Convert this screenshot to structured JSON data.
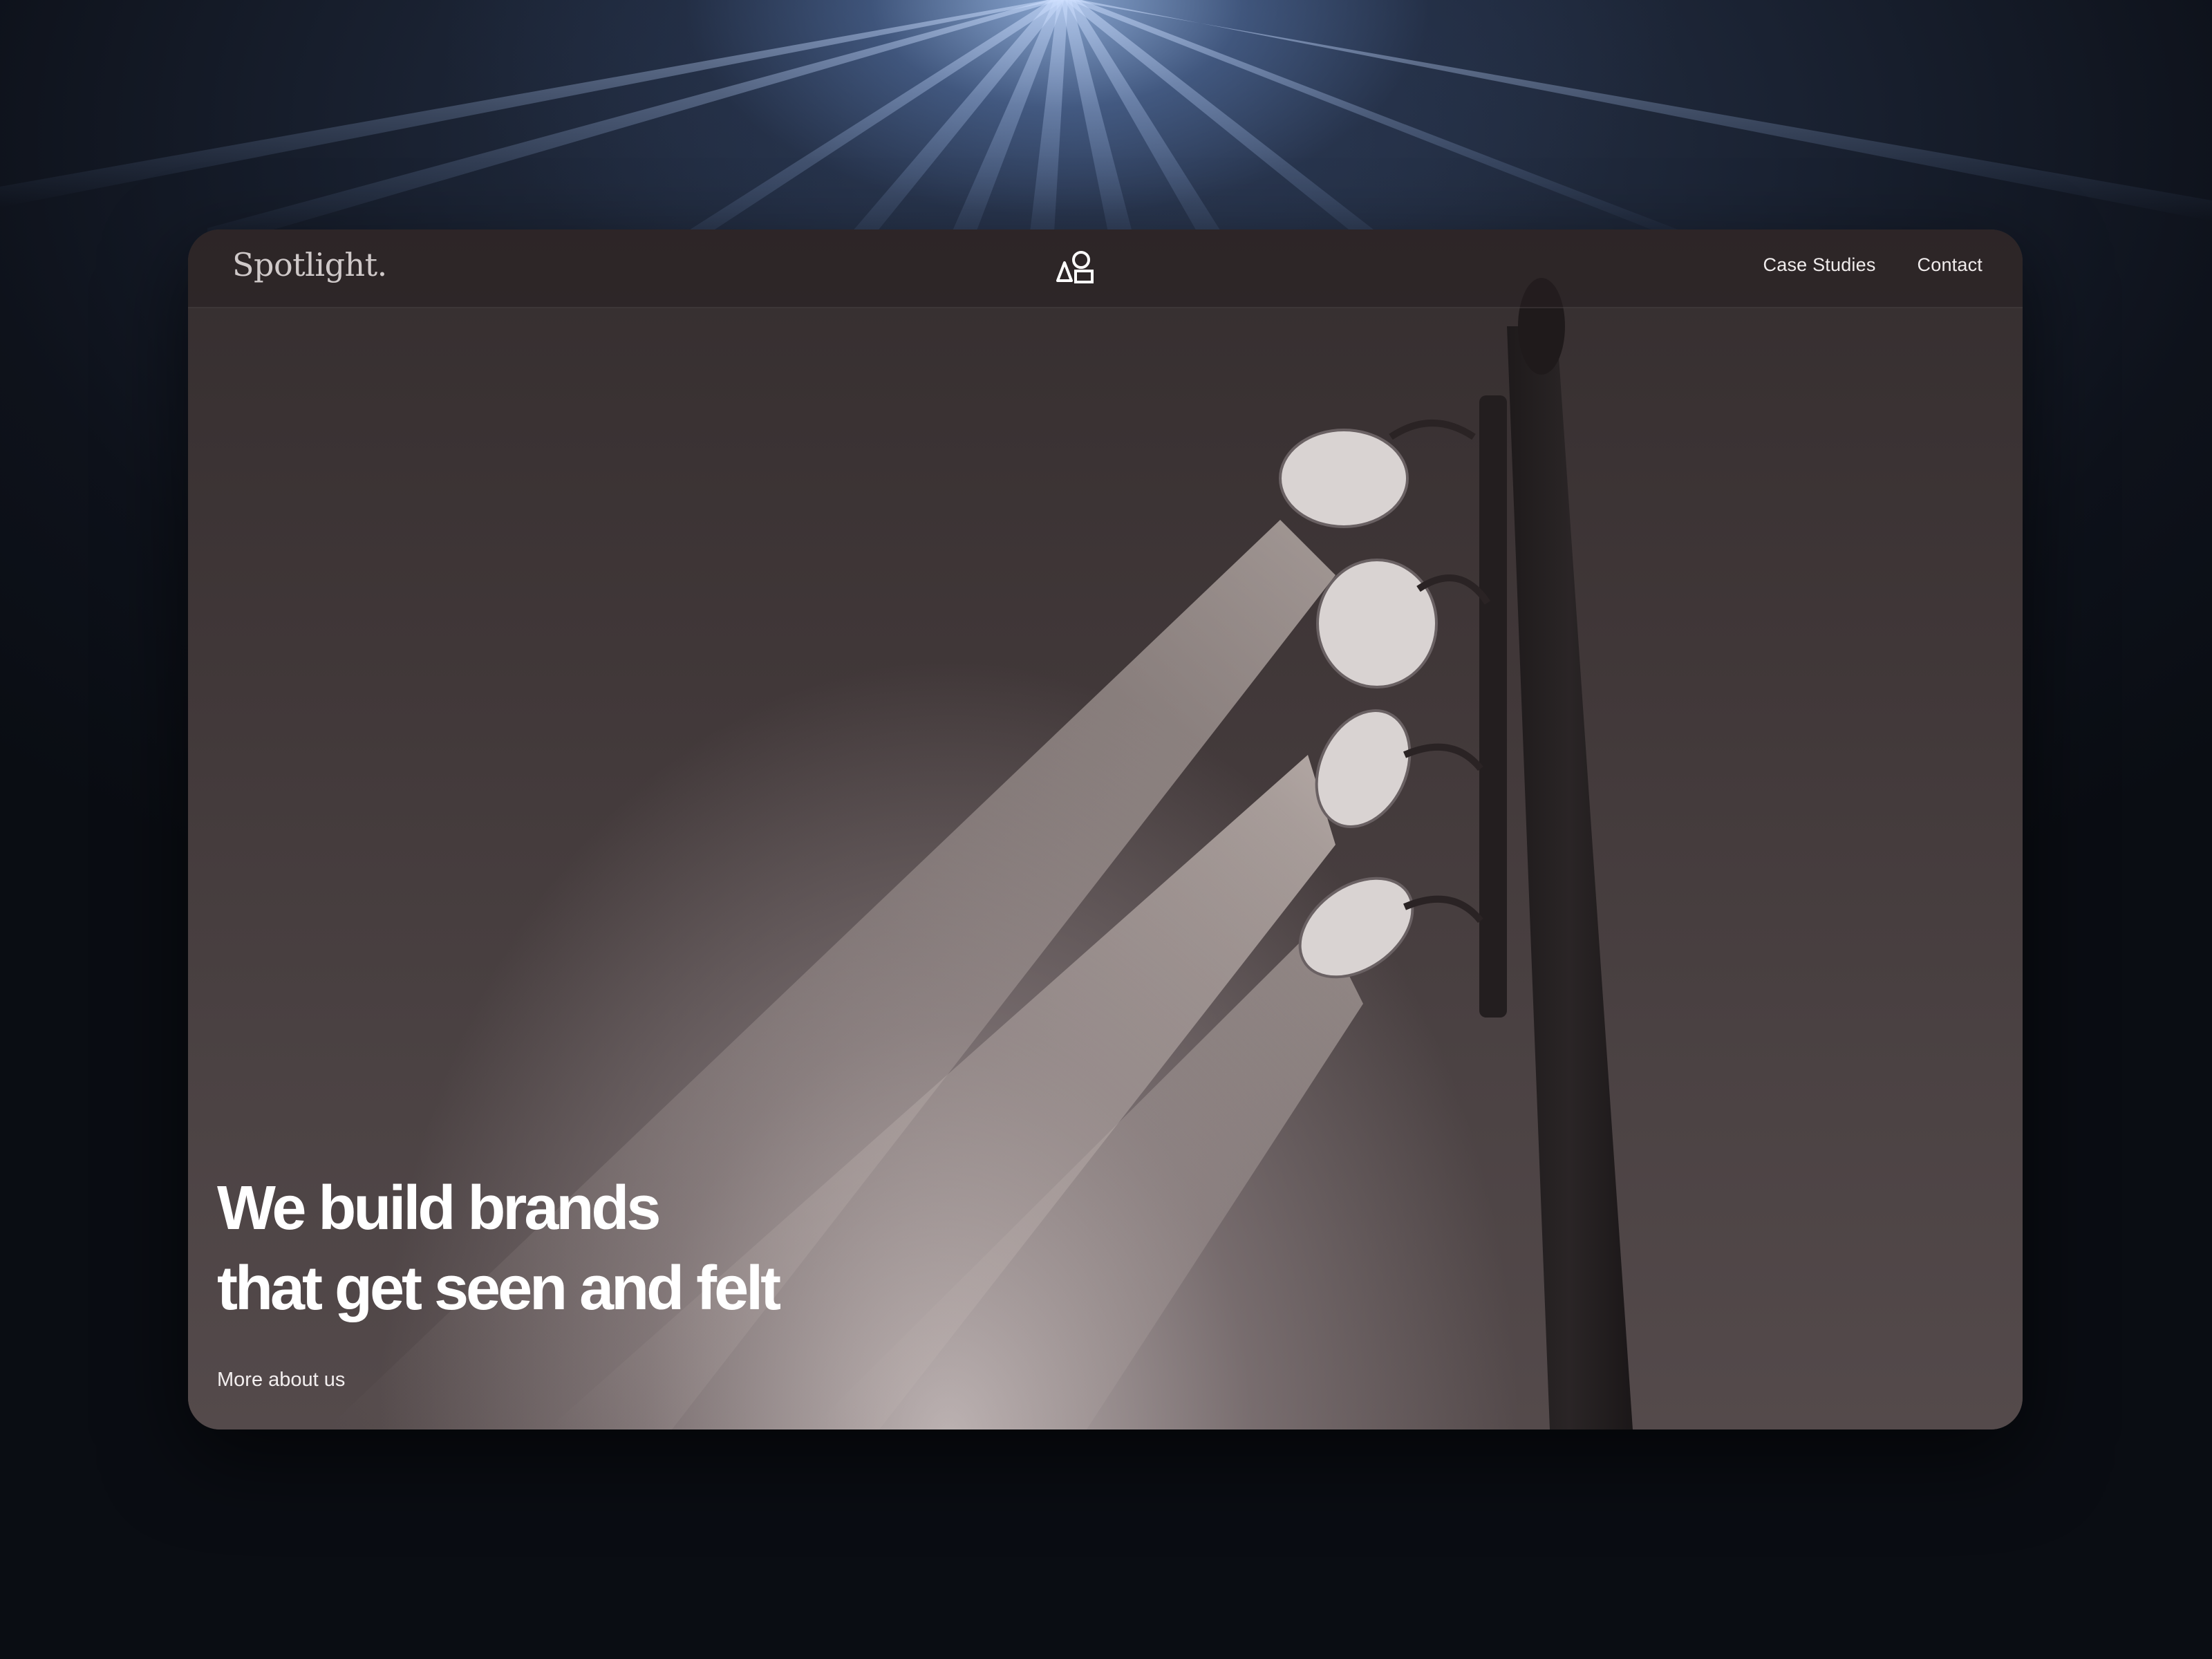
{
  "site": {
    "brand": "Spotlight.",
    "logo_icon": "shapes-icon"
  },
  "nav": {
    "items": [
      {
        "label": "Case Studies"
      },
      {
        "label": "Contact"
      }
    ]
  },
  "hero": {
    "title_line_1": "We build brands",
    "title_line_2": "that get seen and felt",
    "cta_label": "More about us",
    "image_subject": "floodlights-on-pole"
  },
  "colors": {
    "background": "#0c0f16",
    "glow": "#aac8ff",
    "card": "#3f3739",
    "text": "#ffffff"
  }
}
